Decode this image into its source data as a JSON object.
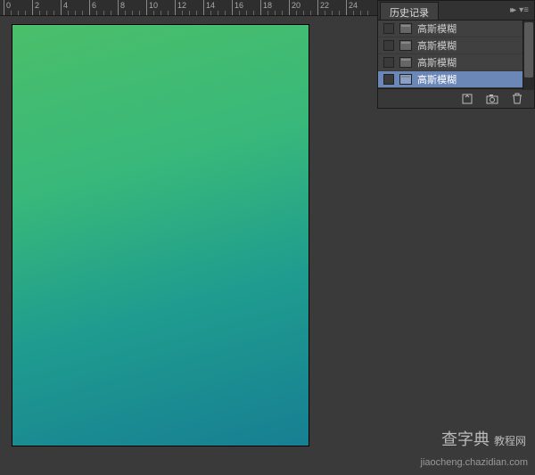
{
  "ruler": {
    "majors": [
      0,
      2,
      4,
      6,
      8,
      10,
      12,
      14,
      16,
      18,
      20,
      22,
      24
    ]
  },
  "panel": {
    "tab_label": "历史记录",
    "items": [
      {
        "label": "高斯模糊",
        "selected": false
      },
      {
        "label": "高斯模糊",
        "selected": false
      },
      {
        "label": "高斯模糊",
        "selected": false
      },
      {
        "label": "高斯模糊",
        "selected": true
      }
    ]
  },
  "watermark": {
    "brand": "查字典",
    "brand_sub": "教程网",
    "url": "jiaocheng.chazidian.com"
  }
}
